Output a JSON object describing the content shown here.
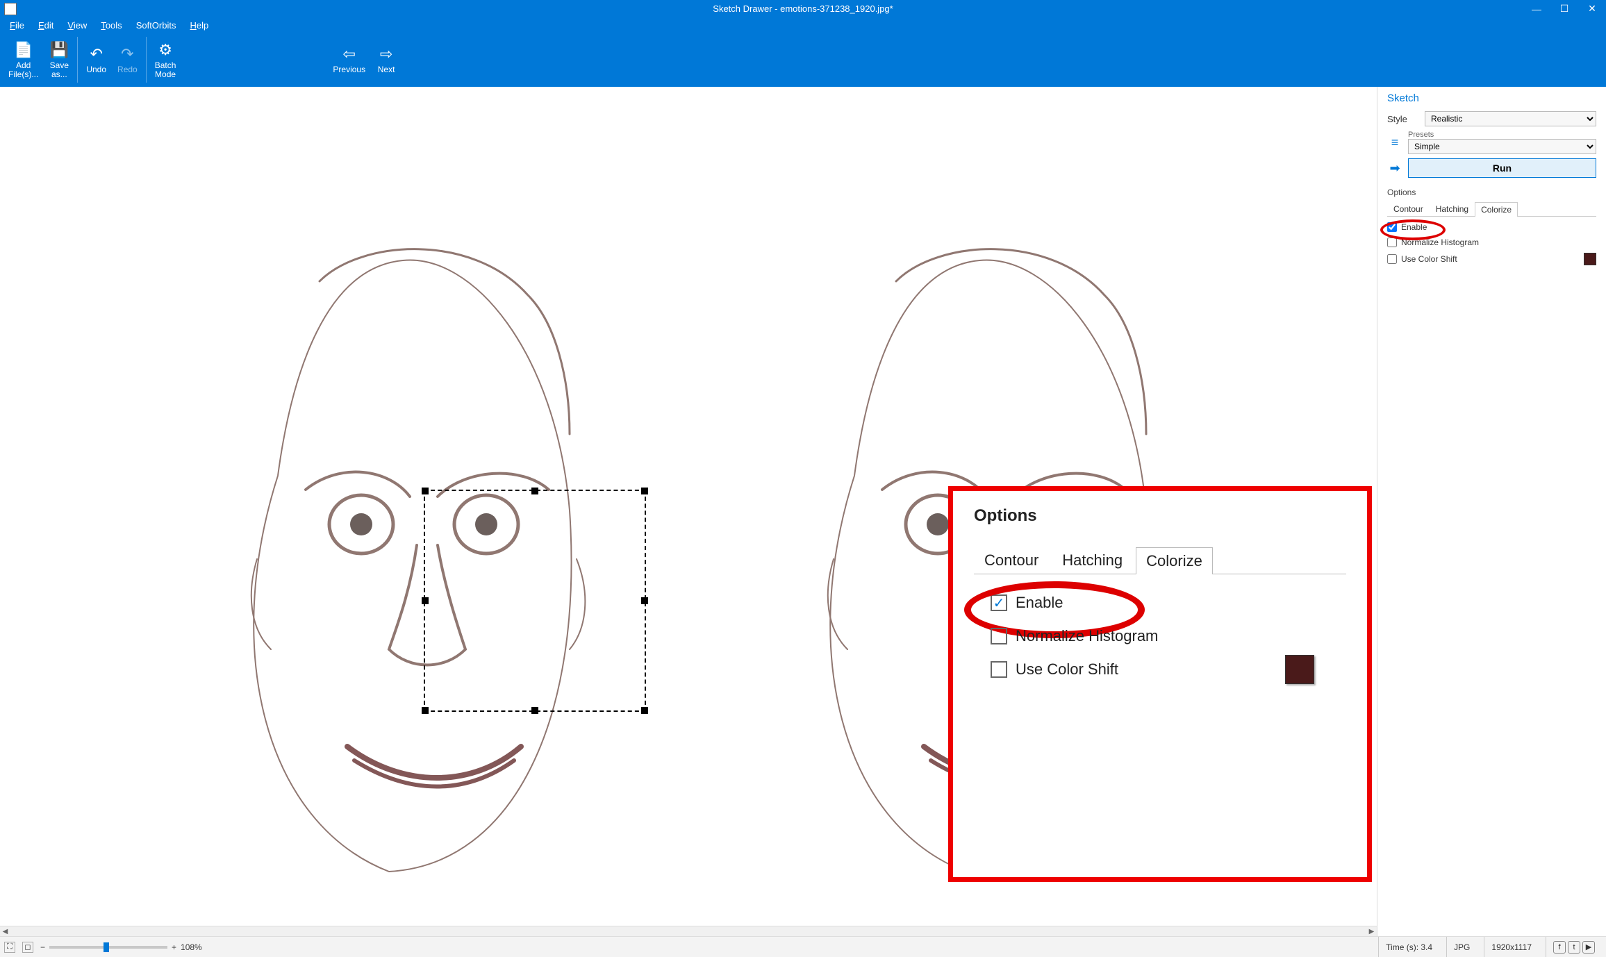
{
  "app": {
    "title": "Sketch Drawer - emotions-371238_1920.jpg*"
  },
  "window_controls": {
    "min": "—",
    "max": "☐",
    "close": "✕"
  },
  "menu": [
    "File",
    "Edit",
    "View",
    "Tools",
    "SoftOrbits",
    "Help"
  ],
  "ribbon": {
    "add": "Add\nFile(s)...",
    "save": "Save\nas...",
    "undo": "Undo",
    "redo": "Redo",
    "batch": "Batch\nMode",
    "prev": "Previous",
    "next": "Next"
  },
  "side": {
    "heading": "Sketch",
    "style_label": "Style",
    "style_value": "Realistic",
    "presets_label": "Presets",
    "presets_value": "Simple",
    "run": "Run",
    "options_label": "Options",
    "tabs": [
      "Contour",
      "Hatching",
      "Colorize"
    ],
    "active_tab": 2,
    "opts": {
      "enable": "Enable",
      "normalize": "Normalize Histogram",
      "shift": "Use Color Shift"
    },
    "color_swatch": "#4a1a1a"
  },
  "callout": {
    "header": "Options",
    "tabs": [
      "Contour",
      "Hatching",
      "Colorize"
    ],
    "active_tab": 2,
    "enable": "Enable",
    "normalize": "Normalize Histogram",
    "shift": "Use Color Shift"
  },
  "status": {
    "zoom_pct": "108%",
    "time": "Time (s): 3.4",
    "format": "JPG",
    "dims": "1920x1117"
  }
}
